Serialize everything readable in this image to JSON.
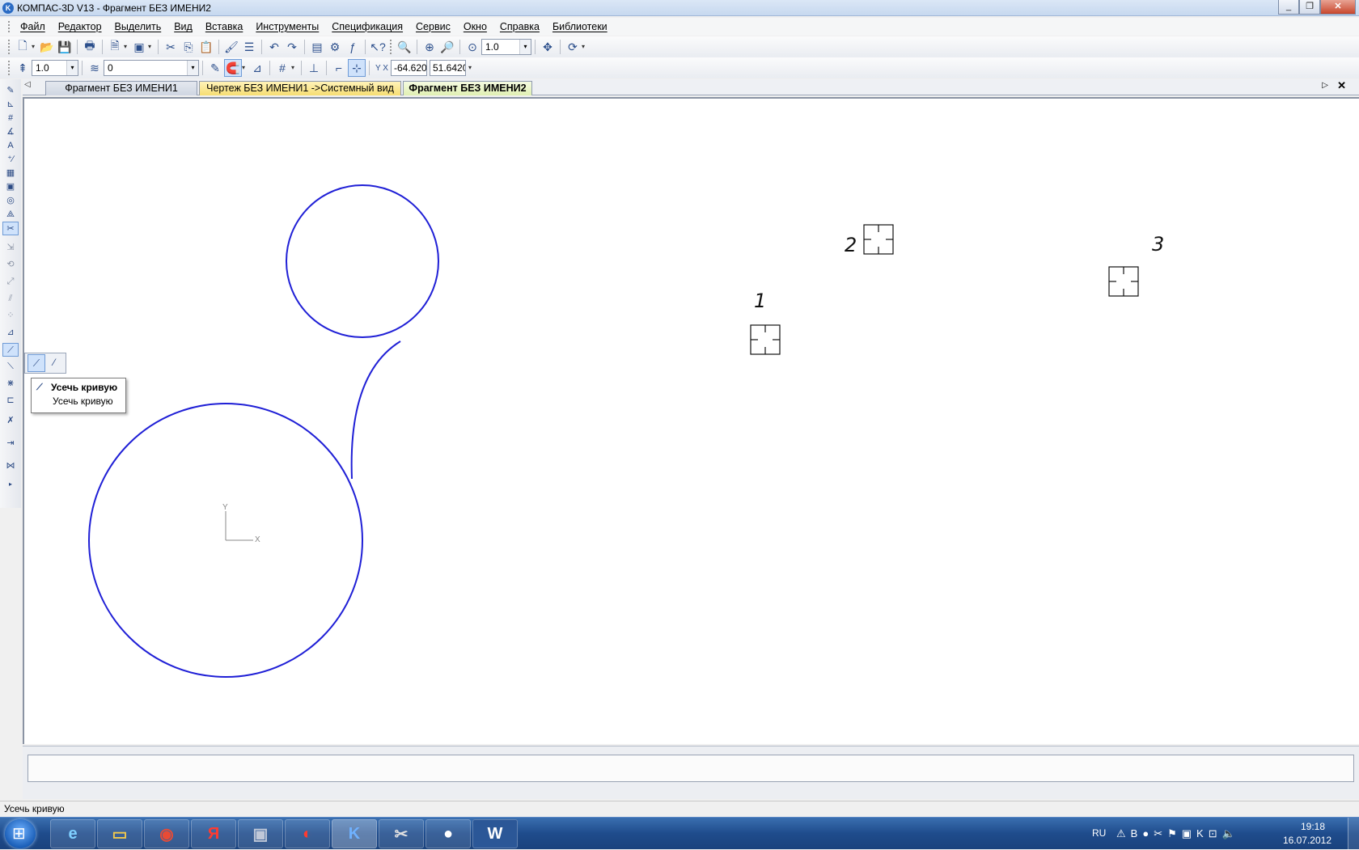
{
  "window": {
    "title": "КОМПАС-3D V13 - Фрагмент БЕЗ ИМЕНИ2",
    "app_icon": "kompas-logo-icon"
  },
  "menu": [
    "Файл",
    "Редактор",
    "Выделить",
    "Вид",
    "Вставка",
    "Инструменты",
    "Спецификация",
    "Сервис",
    "Окно",
    "Справка",
    "Библиотеки"
  ],
  "toolbar1": {
    "zoom_value": "1.0"
  },
  "toolbar2": {
    "step_value": "1.0",
    "layer_value": "0",
    "coord_x": "-64.620",
    "coord_y": "51.6420",
    "coord_label": "Y X"
  },
  "tabs": [
    "Фрагмент БЕЗ ИМЕНИ1",
    "Чертеж БЕЗ ИМЕНИ1 ->Системный вид",
    "Фрагмент БЕЗ ИМЕНИ2"
  ],
  "drawing": {
    "point_labels": [
      "1",
      "2",
      "3"
    ],
    "axis_labels": {
      "x": "X",
      "y": "Y"
    },
    "stroke_color": "#1f1fd6"
  },
  "tooltip": {
    "title": "Усечь кривую",
    "text": "Усечь кривую"
  },
  "status": {
    "text": "Усечь кривую"
  },
  "tray": {
    "lang": "RU",
    "time": "19:18",
    "date": "16.07.2012"
  }
}
